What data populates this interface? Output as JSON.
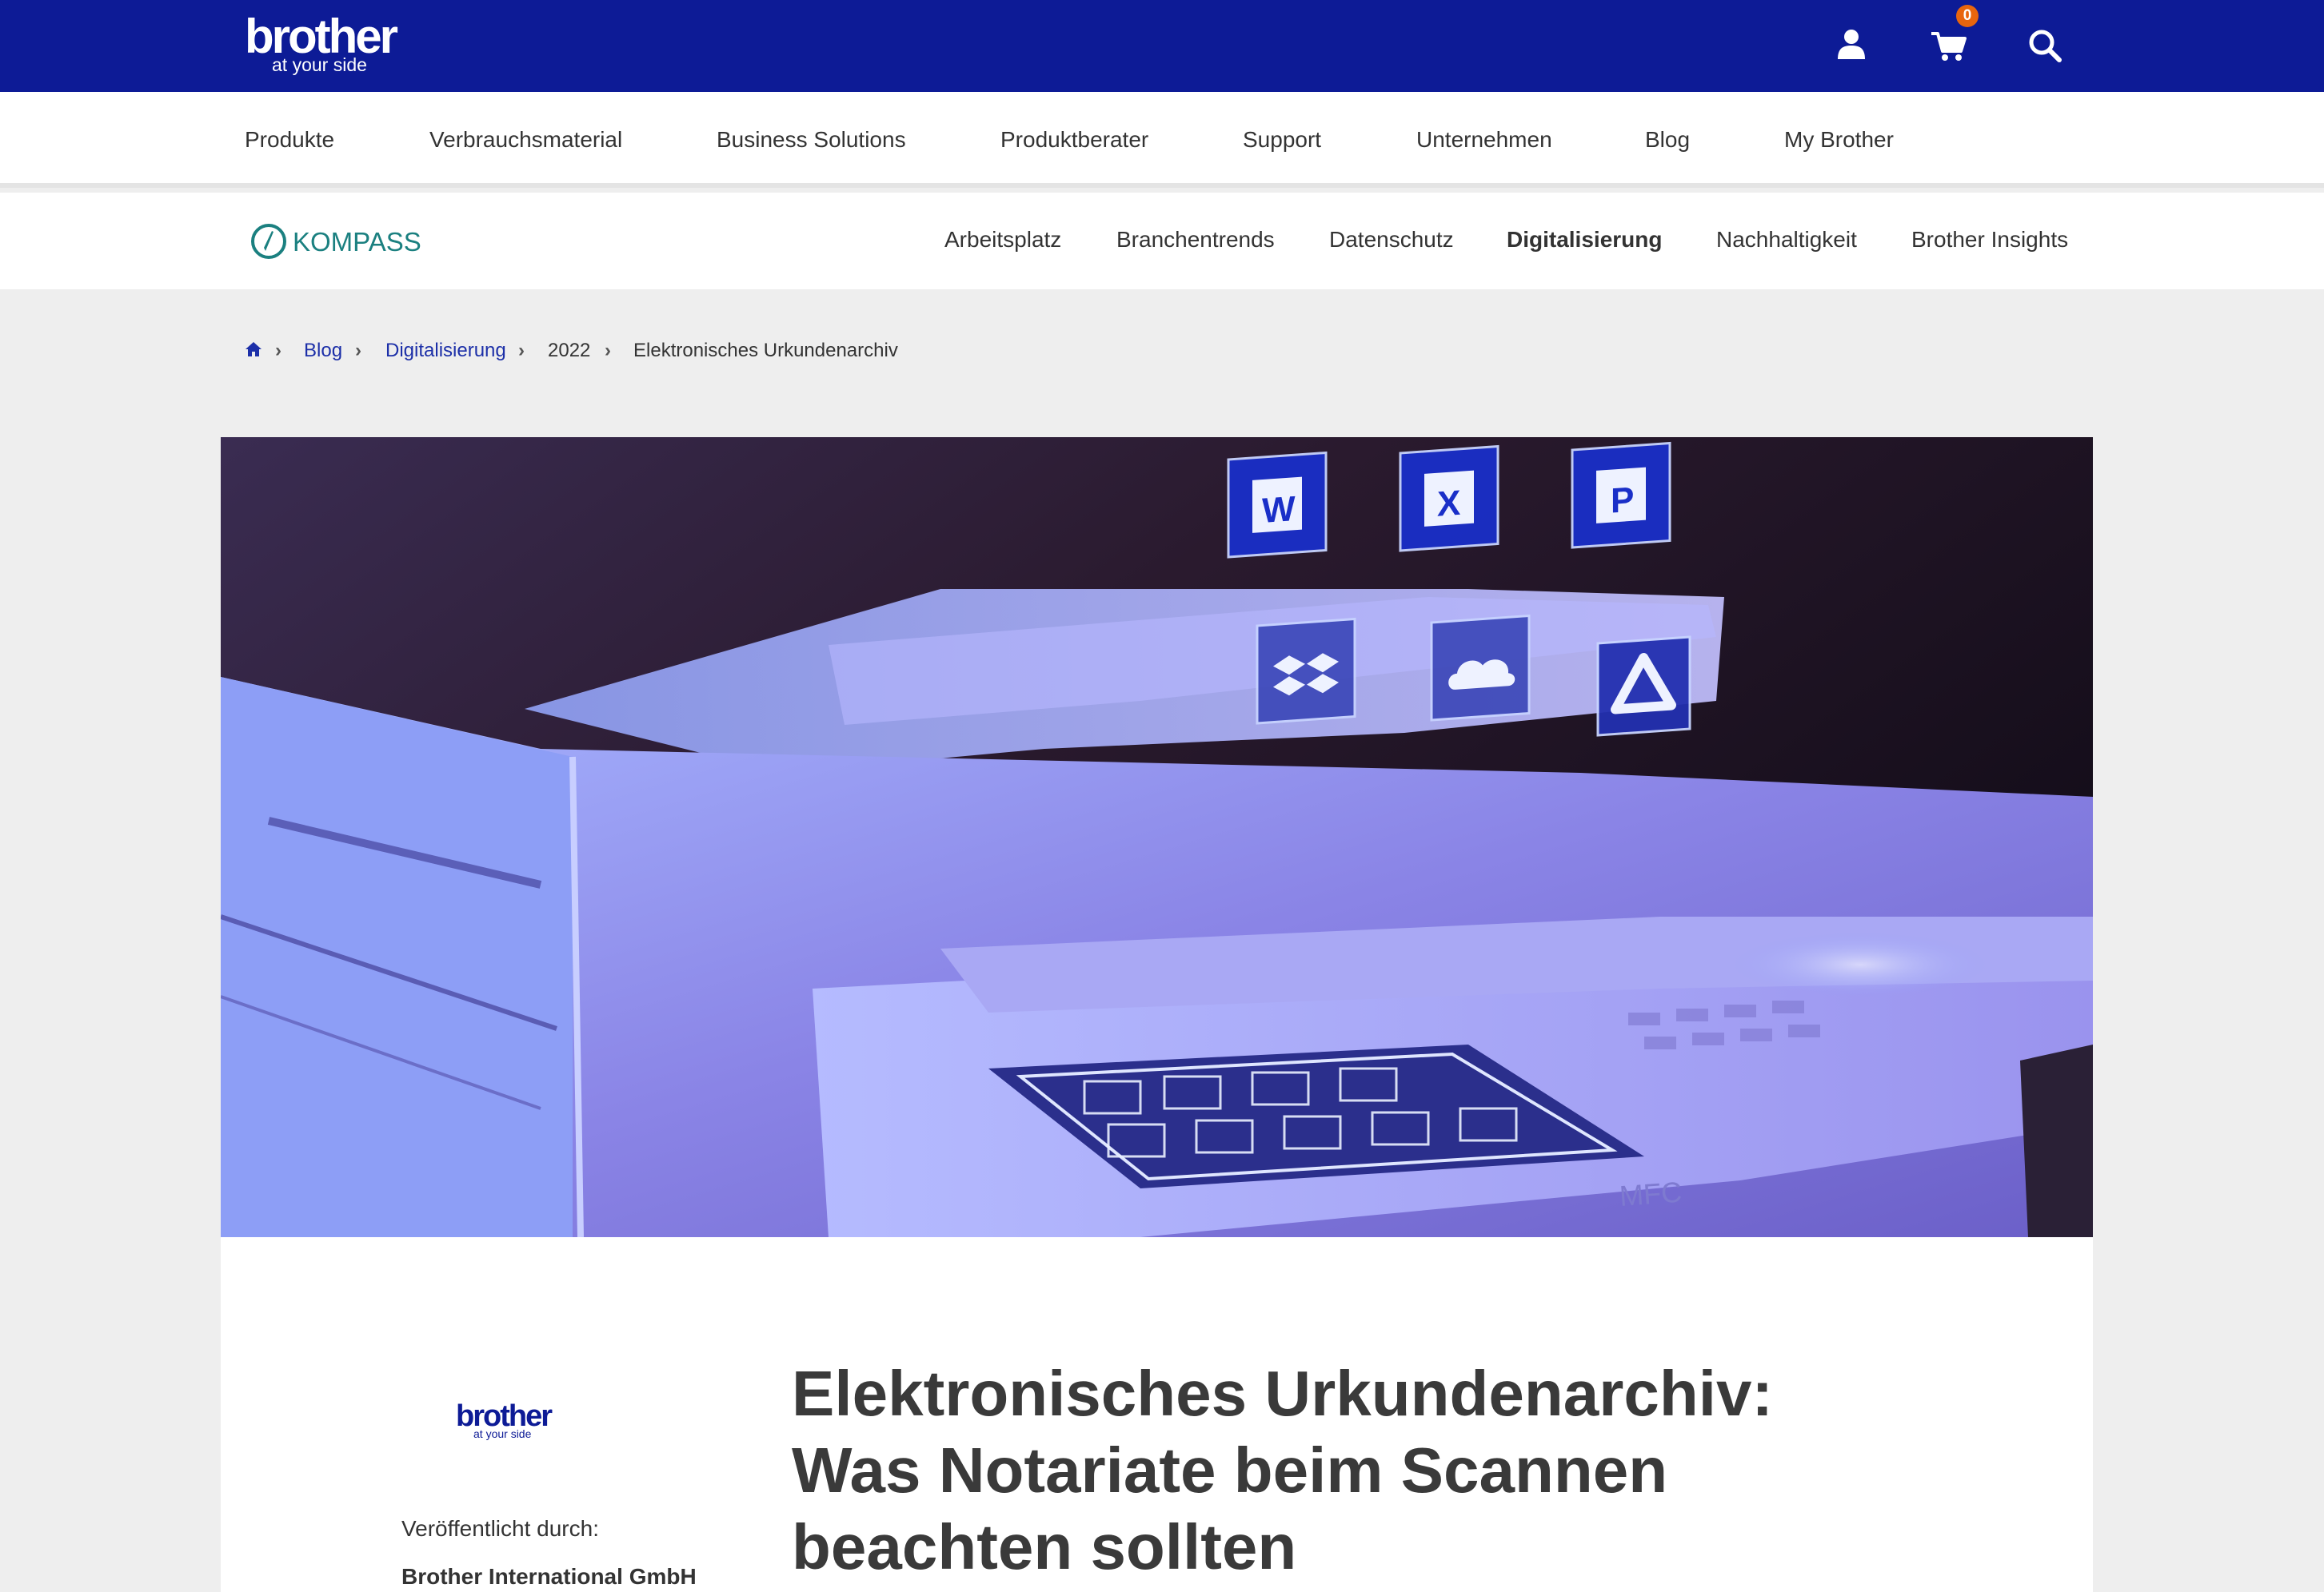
{
  "header": {
    "logo_word": "brother",
    "logo_tagline": "at your side",
    "cart_count": "0",
    "icons": [
      "user-icon",
      "cart-icon",
      "search-icon"
    ]
  },
  "main_nav": {
    "items": [
      "Produkte",
      "Verbrauchsmaterial",
      "Business Solutions",
      "Produktberater",
      "Support",
      "Unternehmen",
      "Blog",
      "My Brother"
    ]
  },
  "kompass_nav": {
    "logo_label": "KOMPASS",
    "items": [
      "Arbeitsplatz",
      "Branchentrends",
      "Datenschutz",
      "Digitalisierung",
      "Nachhaltigkeit",
      "Brother Insights"
    ],
    "active": "Digitalisierung"
  },
  "breadcrumb": {
    "home_icon": "home-icon",
    "items": [
      "Blog",
      "Digitalisierung",
      "2022",
      "Elektronisches Urkundenarchiv"
    ]
  },
  "hero": {
    "image_subject": "printer-with-cloud-app-icons",
    "app_icons": [
      "word-icon",
      "excel-icon",
      "powerpoint-icon",
      "dropbox-icon",
      "onedrive-icon",
      "google-drive-icon"
    ],
    "panel_text": "MFC"
  },
  "article": {
    "author_logo_word": "brother",
    "author_logo_tagline": "at your side",
    "published_label": "Veröffentlicht durch:",
    "publisher": "Brother International GmbH",
    "title_lines": [
      "Elektronisches Urkundenarchiv:",
      "Was Notariate beim Scannen",
      "beachten sollten"
    ]
  },
  "colors": {
    "brand_blue": "#0d1b96",
    "badge_orange": "#e8650d",
    "kompass_teal": "#1b8080",
    "link_blue": "#1c2fa8"
  }
}
